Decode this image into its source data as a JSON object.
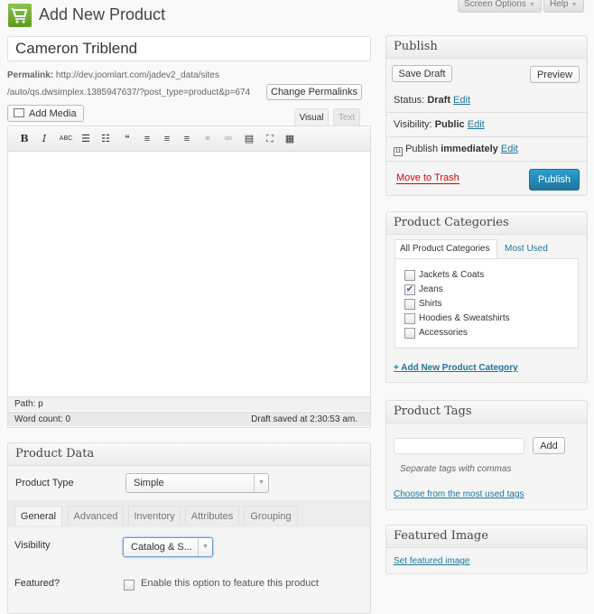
{
  "top": {
    "screen_options": "Screen Options",
    "help": "Help"
  },
  "header": {
    "title": "Add New Product"
  },
  "post": {
    "title_value": "Cameron Triblend",
    "permalink_label": "Permalink:",
    "permalink_line1": "http://dev.joomlart.com/jadev2_data/sites",
    "permalink_line2": "/auto/qs.dwsimplex.1385947637/?post_type=product&p=674",
    "change_permalinks": "Change Permalinks"
  },
  "editor": {
    "add_media": "Add Media",
    "tab_visual": "Visual",
    "tab_text": "Text",
    "toolbar": [
      "bold",
      "italic",
      "strikethrough",
      "bullet-list",
      "numbered-list",
      "blockquote",
      "align-left",
      "align-center",
      "align-right",
      "insert-link",
      "unlink",
      "read-more",
      "fullscreen",
      "kitchen-sink"
    ],
    "path": "Path: p",
    "word_count": "Word count: 0",
    "draft_saved": "Draft saved at 2:30:53 am."
  },
  "publish": {
    "title": "Publish",
    "save_draft": "Save Draft",
    "preview": "Preview",
    "status_label": "Status:",
    "status_value": "Draft",
    "visibility_label": "Visibility:",
    "visibility_value": "Public",
    "publish_label": "Publish",
    "publish_value": "immediately",
    "edit": "Edit",
    "move_to_trash": "Move to Trash",
    "publish_button": "Publish"
  },
  "categories": {
    "title": "Product Categories",
    "tab_all": "All Product Categories",
    "tab_most_used": "Most Used",
    "items": [
      {
        "label": "Jackets & Coats",
        "checked": false
      },
      {
        "label": "Jeans",
        "checked": true
      },
      {
        "label": "Shirts",
        "checked": false
      },
      {
        "label": "Hoodies & Sweatshirts",
        "checked": false
      },
      {
        "label": "Accessories",
        "checked": false
      }
    ],
    "add_new": "+ Add New Product Category"
  },
  "tags": {
    "title": "Product Tags",
    "input_value": "",
    "add": "Add",
    "hint": "Separate tags with commas",
    "choose": "Choose from the most used tags"
  },
  "featured_image": {
    "title": "Featured Image",
    "set": "Set featured image"
  },
  "product_data": {
    "title": "Product Data",
    "type_label": "Product Type",
    "type_value": "Simple",
    "tabs": [
      "General",
      "Advanced",
      "Inventory",
      "Attributes",
      "Grouping"
    ],
    "visibility_label": "Visibility",
    "visibility_value": "Catalog & S...",
    "featured_label": "Featured?",
    "featured_text": "Enable this option to feature this product"
  },
  "colors": {
    "accent": "#21759b",
    "publish_btn": "#2a8bbf",
    "trash": "#d00000",
    "icon_green": "#76b03a"
  }
}
